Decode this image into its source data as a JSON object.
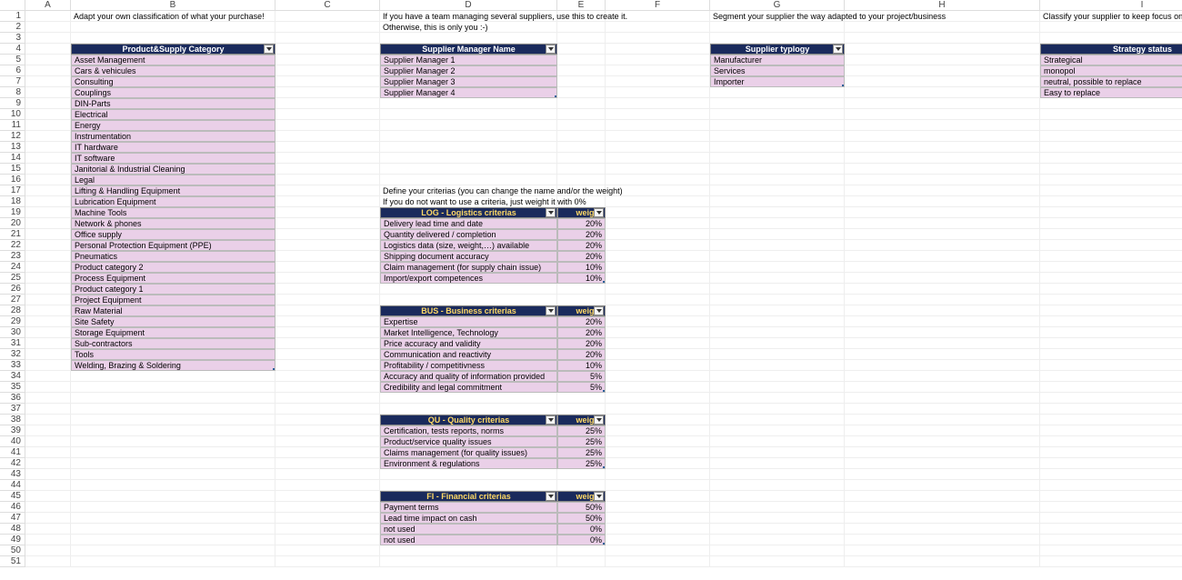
{
  "columns": [
    "A",
    "B",
    "C",
    "D",
    "E",
    "F",
    "G",
    "H",
    "I"
  ],
  "rowCount": 51,
  "row1": {
    "B": "Adapt your own classification of what your purchase!",
    "D": "If you have a team managing several suppliers, use this to create it.",
    "G": "Segment your supplier the way adapted to your project/business",
    "I": "Classify your supplier to keep focus on what matters"
  },
  "row2": {
    "D": "Otherwise, this is only you :-)"
  },
  "tables": {
    "productSupply": {
      "header": "Product&Supply Category",
      "items": [
        "Asset Management",
        "Cars & vehicules",
        "Consulting",
        "Couplings",
        "DIN-Parts",
        "Electrical",
        "Energy",
        "Instrumentation",
        "IT hardware",
        "IT software",
        "Janitorial & Industrial Cleaning",
        "Legal",
        "Lifting & Handling Equipment",
        "Lubrication Equipment",
        "Machine Tools",
        "Network & phones",
        "Office supply",
        "Personal Protection Equipment (PPE)",
        "Pneumatics",
        "Product category 2",
        "Process Equipment",
        "Product category 1",
        "Project Equipment",
        "Raw Material",
        "Site Safety",
        "Storage Equipment",
        "Sub-contractors",
        "Tools",
        "Welding, Brazing & Soldering"
      ]
    },
    "supplierManager": {
      "header": "Supplier Manager Name",
      "items": [
        "Supplier Manager 1",
        "Supplier Manager 2",
        "Supplier Manager 3",
        "Supplier Manager 4"
      ]
    },
    "typology": {
      "header": "Supplier typlogy",
      "items": [
        "Manufacturer",
        "Services",
        "Importer"
      ]
    },
    "strategy": {
      "header": "Strategy status",
      "items": [
        "Strategical",
        "monopol",
        "neutral, possible to replace",
        "Easy to replace"
      ]
    }
  },
  "criteriaIntro": {
    "line1": "Define your criterias (you can change the name and/or the weight)",
    "line2": "If you do not want to use a criteria, just weight it with 0%"
  },
  "criteriaBlocks": [
    {
      "title": "LOG - Logistics criterias",
      "rows": [
        [
          "Delivery lead time and date",
          "20%"
        ],
        [
          "Quantity delivered / completion",
          "20%"
        ],
        [
          "Logistics data (size, weight,…) available",
          "20%"
        ],
        [
          "Shipping document accuracy",
          "20%"
        ],
        [
          "Claim management (for supply chain issue)",
          "10%"
        ],
        [
          "Import/export competences",
          "10%"
        ]
      ]
    },
    {
      "title": "BUS - Business criterias",
      "rows": [
        [
          "Expertise",
          "20%"
        ],
        [
          "Market Intelligence, Technology",
          "20%"
        ],
        [
          "Price accuracy and validity",
          "20%"
        ],
        [
          "Communication and reactivity",
          "20%"
        ],
        [
          "Profitability / competitivness",
          "10%"
        ],
        [
          "Accuracy and quality of information provided",
          "5%"
        ],
        [
          "Credibility and legal commitment",
          "5%"
        ]
      ]
    },
    {
      "title": "QU - Quality criterias",
      "rows": [
        [
          "Certification, tests reports, norms",
          "25%"
        ],
        [
          "Product/service quality issues",
          "25%"
        ],
        [
          "Claims management (for quality issues)",
          "25%"
        ],
        [
          "Environment & regulations",
          "25%"
        ]
      ]
    },
    {
      "title": "FI - Financial criterias",
      "rows": [
        [
          "Payment terms",
          "50%"
        ],
        [
          "Lead time impact on cash",
          "50%"
        ],
        [
          "not used",
          "0%"
        ],
        [
          "not used",
          "0%"
        ]
      ]
    }
  ],
  "weightLabel": "weight"
}
